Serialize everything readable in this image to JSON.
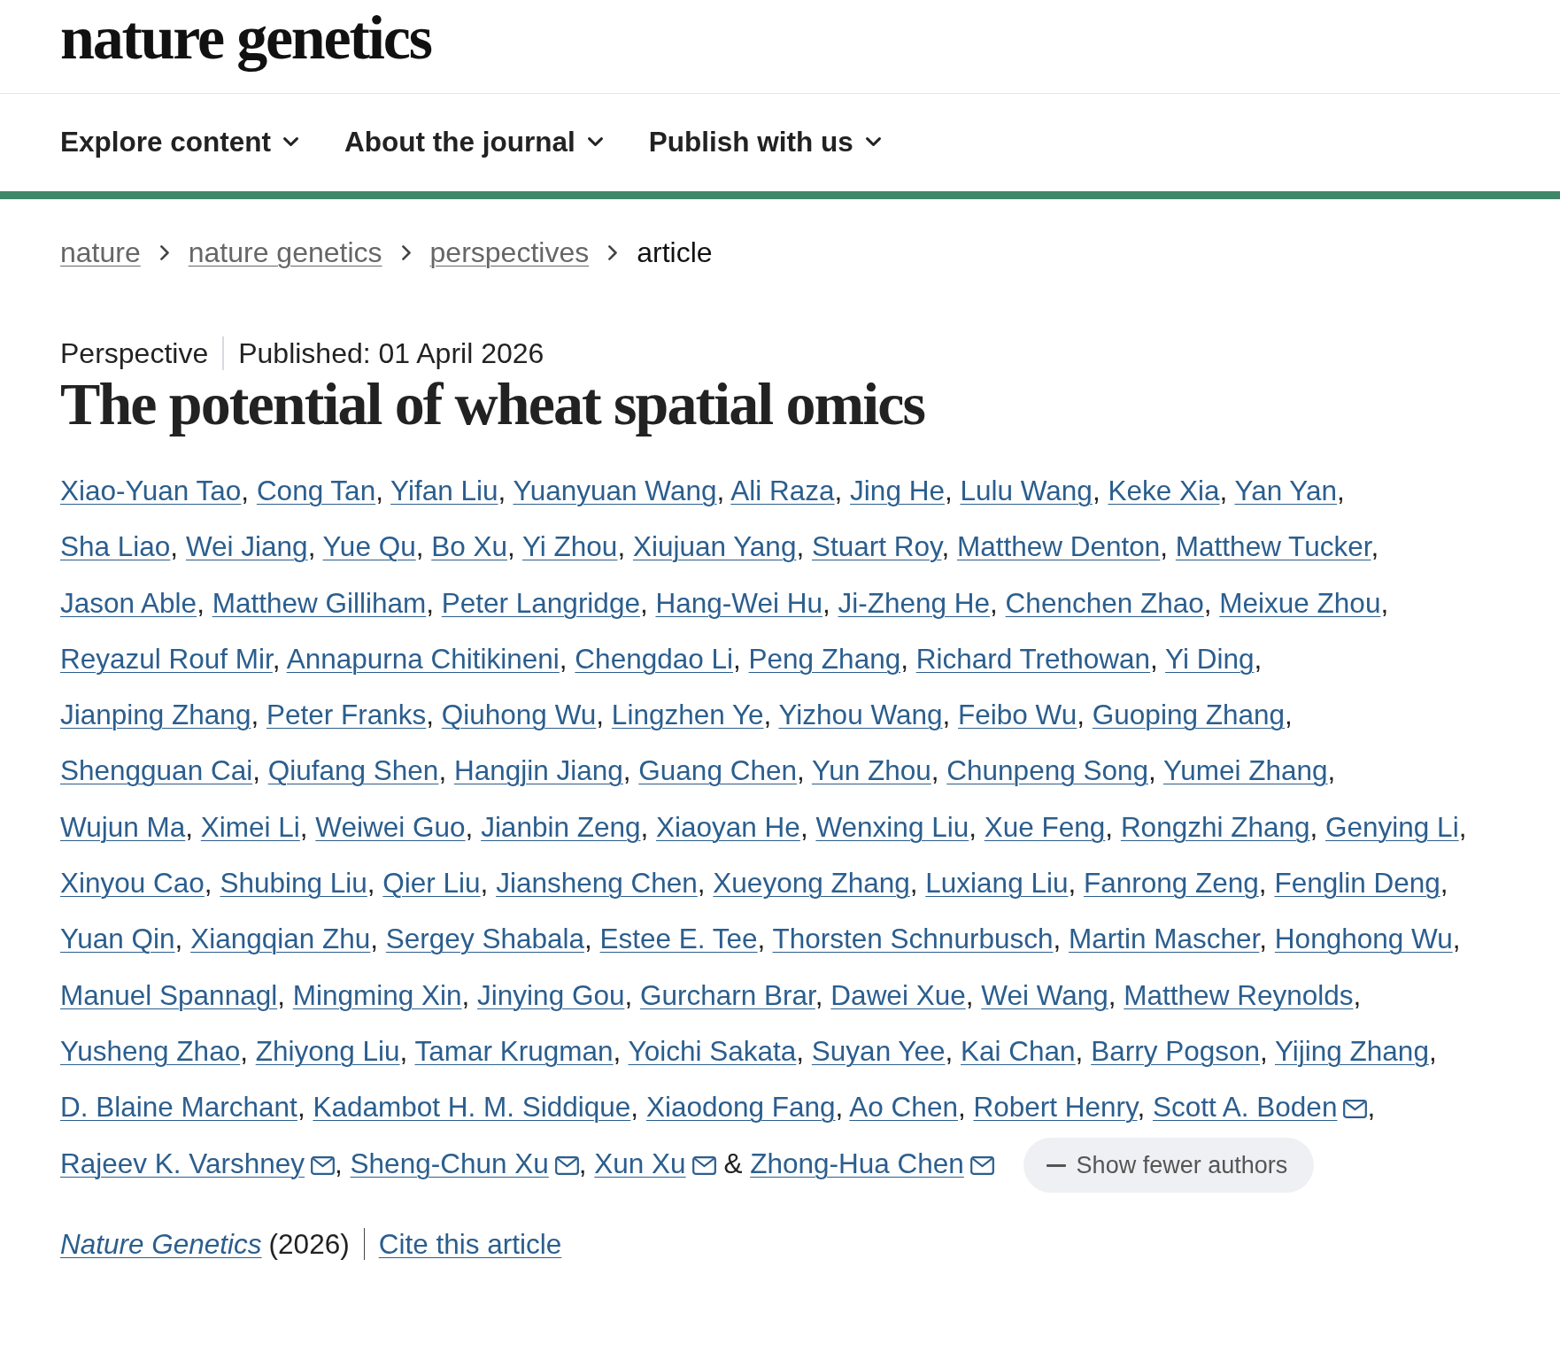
{
  "header": {
    "logo": "nature genetics"
  },
  "nav": [
    {
      "label": "Explore content"
    },
    {
      "label": "About the journal"
    },
    {
      "label": "Publish with us"
    }
  ],
  "breadcrumb": [
    {
      "label": "nature",
      "current": false
    },
    {
      "label": "nature genetics",
      "current": false
    },
    {
      "label": "perspectives",
      "current": false
    },
    {
      "label": "article",
      "current": true
    }
  ],
  "article": {
    "type": "Perspective",
    "published": "Published: 01 April 2026",
    "title": "The potential of wheat spatial omics",
    "authors": [
      {
        "name": "Xiao-Yuan Tao",
        "corresponding": false,
        "separator": ","
      },
      {
        "name": "Cong Tan",
        "corresponding": false,
        "separator": ","
      },
      {
        "name": "Yifan Liu",
        "corresponding": false,
        "separator": ","
      },
      {
        "name": "Yuanyuan Wang",
        "corresponding": false,
        "separator": ","
      },
      {
        "name": "Ali Raza",
        "corresponding": false,
        "separator": ","
      },
      {
        "name": "Jing He",
        "corresponding": false,
        "separator": ","
      },
      {
        "name": "Lulu Wang",
        "corresponding": false,
        "separator": ","
      },
      {
        "name": "Keke Xia",
        "corresponding": false,
        "separator": ","
      },
      {
        "name": "Yan Yan",
        "corresponding": false,
        "separator": ","
      },
      {
        "name": "Sha Liao",
        "corresponding": false,
        "separator": ","
      },
      {
        "name": "Wei Jiang",
        "corresponding": false,
        "separator": ","
      },
      {
        "name": "Yue Qu",
        "corresponding": false,
        "separator": ","
      },
      {
        "name": "Bo Xu",
        "corresponding": false,
        "separator": ","
      },
      {
        "name": "Yi Zhou",
        "corresponding": false,
        "separator": ","
      },
      {
        "name": "Xiujuan Yang",
        "corresponding": false,
        "separator": ","
      },
      {
        "name": "Stuart Roy",
        "corresponding": false,
        "separator": ","
      },
      {
        "name": "Matthew Denton",
        "corresponding": false,
        "separator": ","
      },
      {
        "name": "Matthew Tucker",
        "corresponding": false,
        "separator": ","
      },
      {
        "name": "Jason Able",
        "corresponding": false,
        "separator": ","
      },
      {
        "name": "Matthew Gilliham",
        "corresponding": false,
        "separator": ","
      },
      {
        "name": "Peter Langridge",
        "corresponding": false,
        "separator": ","
      },
      {
        "name": "Hang-Wei Hu",
        "corresponding": false,
        "separator": ","
      },
      {
        "name": "Ji-Zheng He",
        "corresponding": false,
        "separator": ","
      },
      {
        "name": "Chenchen Zhao",
        "corresponding": false,
        "separator": ","
      },
      {
        "name": "Meixue Zhou",
        "corresponding": false,
        "separator": ","
      },
      {
        "name": "Reyazul Rouf Mir",
        "corresponding": false,
        "separator": ","
      },
      {
        "name": "Annapurna Chitikineni",
        "corresponding": false,
        "separator": ","
      },
      {
        "name": "Chengdao Li",
        "corresponding": false,
        "separator": ","
      },
      {
        "name": "Peng Zhang",
        "corresponding": false,
        "separator": ","
      },
      {
        "name": "Richard Trethowan",
        "corresponding": false,
        "separator": ","
      },
      {
        "name": "Yi Ding",
        "corresponding": false,
        "separator": ","
      },
      {
        "name": "Jianping Zhang",
        "corresponding": false,
        "separator": ","
      },
      {
        "name": "Peter Franks",
        "corresponding": false,
        "separator": ","
      },
      {
        "name": "Qiuhong Wu",
        "corresponding": false,
        "separator": ","
      },
      {
        "name": "Lingzhen Ye",
        "corresponding": false,
        "separator": ","
      },
      {
        "name": "Yizhou Wang",
        "corresponding": false,
        "separator": ","
      },
      {
        "name": "Feibo Wu",
        "corresponding": false,
        "separator": ","
      },
      {
        "name": "Guoping Zhang",
        "corresponding": false,
        "separator": ","
      },
      {
        "name": "Shengguan Cai",
        "corresponding": false,
        "separator": ","
      },
      {
        "name": "Qiufang Shen",
        "corresponding": false,
        "separator": ","
      },
      {
        "name": "Hangjin Jiang",
        "corresponding": false,
        "separator": ","
      },
      {
        "name": "Guang Chen",
        "corresponding": false,
        "separator": ","
      },
      {
        "name": "Yun Zhou",
        "corresponding": false,
        "separator": ","
      },
      {
        "name": "Chunpeng Song",
        "corresponding": false,
        "separator": ","
      },
      {
        "name": "Yumei Zhang",
        "corresponding": false,
        "separator": ","
      },
      {
        "name": "Wujun Ma",
        "corresponding": false,
        "separator": ","
      },
      {
        "name": "Ximei Li",
        "corresponding": false,
        "separator": ","
      },
      {
        "name": "Weiwei Guo",
        "corresponding": false,
        "separator": ","
      },
      {
        "name": "Jianbin Zeng",
        "corresponding": false,
        "separator": ","
      },
      {
        "name": "Xiaoyan He",
        "corresponding": false,
        "separator": ","
      },
      {
        "name": "Wenxing Liu",
        "corresponding": false,
        "separator": ","
      },
      {
        "name": "Xue Feng",
        "corresponding": false,
        "separator": ","
      },
      {
        "name": "Rongzhi Zhang",
        "corresponding": false,
        "separator": ","
      },
      {
        "name": "Genying Li",
        "corresponding": false,
        "separator": ","
      },
      {
        "name": "Xinyou Cao",
        "corresponding": false,
        "separator": ","
      },
      {
        "name": "Shubing Liu",
        "corresponding": false,
        "separator": ","
      },
      {
        "name": "Qier Liu",
        "corresponding": false,
        "separator": ","
      },
      {
        "name": "Jiansheng Chen",
        "corresponding": false,
        "separator": ","
      },
      {
        "name": "Xueyong Zhang",
        "corresponding": false,
        "separator": ","
      },
      {
        "name": "Luxiang Liu",
        "corresponding": false,
        "separator": ","
      },
      {
        "name": "Fanrong Zeng",
        "corresponding": false,
        "separator": ","
      },
      {
        "name": "Fenglin Deng",
        "corresponding": false,
        "separator": ","
      },
      {
        "name": "Yuan Qin",
        "corresponding": false,
        "separator": ","
      },
      {
        "name": "Xiangqian Zhu",
        "corresponding": false,
        "separator": ","
      },
      {
        "name": "Sergey Shabala",
        "corresponding": false,
        "separator": ","
      },
      {
        "name": "Estee E. Tee",
        "corresponding": false,
        "separator": ","
      },
      {
        "name": "Thorsten Schnurbusch",
        "corresponding": false,
        "separator": ","
      },
      {
        "name": "Martin Mascher",
        "corresponding": false,
        "separator": ","
      },
      {
        "name": "Honghong Wu",
        "corresponding": false,
        "separator": ","
      },
      {
        "name": "Manuel Spannagl",
        "corresponding": false,
        "separator": ","
      },
      {
        "name": "Mingming Xin",
        "corresponding": false,
        "separator": ","
      },
      {
        "name": "Jinying Gou",
        "corresponding": false,
        "separator": ","
      },
      {
        "name": "Gurcharn Brar",
        "corresponding": false,
        "separator": ","
      },
      {
        "name": "Dawei Xue",
        "corresponding": false,
        "separator": ","
      },
      {
        "name": "Wei Wang",
        "corresponding": false,
        "separator": ","
      },
      {
        "name": "Matthew Reynolds",
        "corresponding": false,
        "separator": ","
      },
      {
        "name": "Yusheng Zhao",
        "corresponding": false,
        "separator": ","
      },
      {
        "name": "Zhiyong Liu",
        "corresponding": false,
        "separator": ","
      },
      {
        "name": "Tamar Krugman",
        "corresponding": false,
        "separator": ","
      },
      {
        "name": "Yoichi Sakata",
        "corresponding": false,
        "separator": ","
      },
      {
        "name": "Suyan Yee",
        "corresponding": false,
        "separator": ","
      },
      {
        "name": "Kai Chan",
        "corresponding": false,
        "separator": ","
      },
      {
        "name": "Barry Pogson",
        "corresponding": false,
        "separator": ","
      },
      {
        "name": "Yijing Zhang",
        "corresponding": false,
        "separator": ","
      },
      {
        "name": "D. Blaine Marchant",
        "corresponding": false,
        "separator": ","
      },
      {
        "name": "Kadambot H. M. Siddique",
        "corresponding": false,
        "separator": ","
      },
      {
        "name": "Xiaodong Fang",
        "corresponding": false,
        "separator": ","
      },
      {
        "name": "Ao Chen",
        "corresponding": false,
        "separator": ","
      },
      {
        "name": "Robert Henry",
        "corresponding": false,
        "separator": ","
      },
      {
        "name": "Scott A. Boden",
        "corresponding": true,
        "separator": ","
      },
      {
        "name": "Rajeev K. Varshney",
        "corresponding": true,
        "separator": ","
      },
      {
        "name": "Sheng-Chun Xu",
        "corresponding": true,
        "separator": ","
      },
      {
        "name": "Xun Xu",
        "corresponding": true,
        "conjunction": "&"
      },
      {
        "name": "Zhong-Hua Chen",
        "corresponding": true
      }
    ],
    "toggle_button": "Show fewer authors",
    "journal": "Nature Genetics",
    "year": "(2026)",
    "cite_link": "Cite this article"
  }
}
